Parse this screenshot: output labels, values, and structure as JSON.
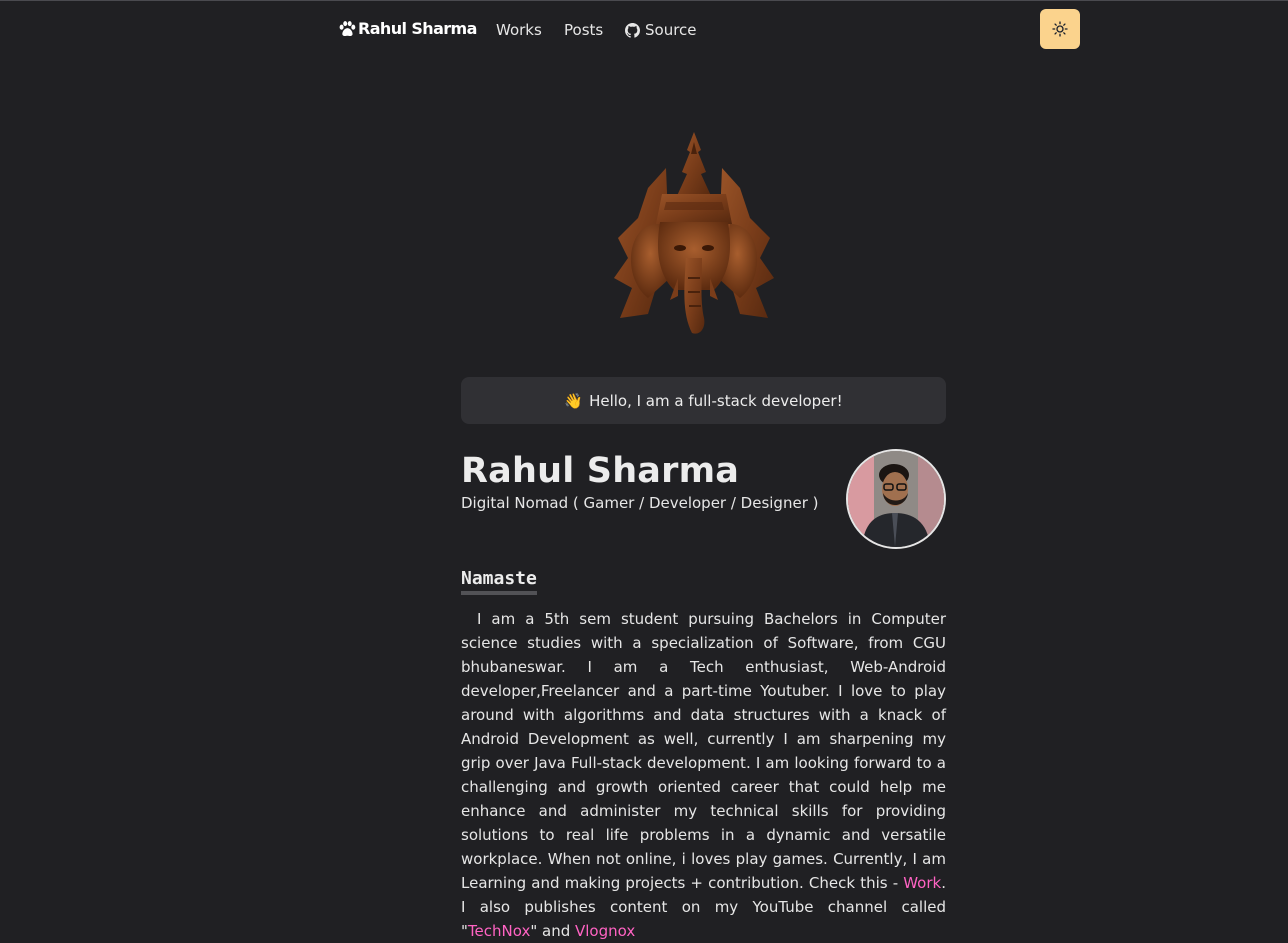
{
  "navbar": {
    "logo_text": "Rahul Sharma",
    "links": [
      {
        "label": "Works"
      },
      {
        "label": "Posts"
      },
      {
        "label": "Source",
        "icon": "github-icon"
      }
    ],
    "theme_toggle_icon": "sun-icon",
    "theme_toggle_color": "#fbd38d"
  },
  "hero": {
    "greeting_emoji": "👋",
    "greeting_text": "Hello, I am a full-stack developer!"
  },
  "profile": {
    "name": "Rahul Sharma",
    "subtitle": "Digital Nomad ( Gamer / Developer / Designer )"
  },
  "section": {
    "title": "Namaste"
  },
  "bio": {
    "part1": "I am a 5th sem student pursuing Bachelors in Computer science studies with a specialization of Software, from CGU bhubaneswar. I am a Tech enthusiast, Web-Android developer,Freelancer and a part-time Youtuber. I love to play around with algorithms and data structures with a knack of Android Development as well, currently I am sharpening my grip over Java Full-stack development. I am looking forward to a challenging and growth oriented career that could help me enhance and administer my technical skills for providing solutions to real life problems in a dynamic and versatile workplace. When not online, i loves play games. Currently, I am Learning and making projects + contribution. Check this - ",
    "link_work": "Work",
    "part2": ". I also publishes content on my YouTube channel called \"",
    "link_technox": "TechNox",
    "part3": "\" and ",
    "link_vlognox": "Vlognox"
  },
  "colors": {
    "background": "#202023",
    "link": "#ff63c3",
    "card": "#303034"
  }
}
